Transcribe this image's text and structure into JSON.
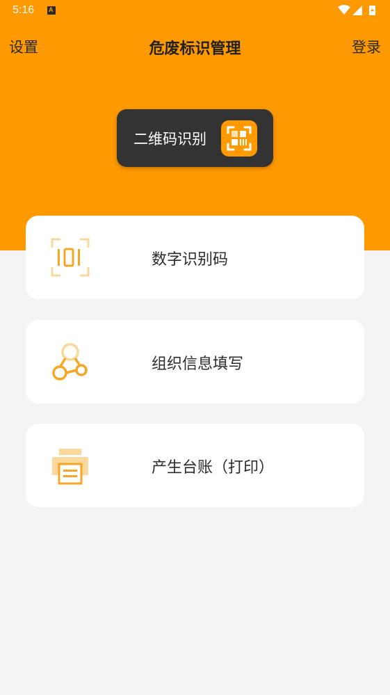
{
  "status_bar": {
    "time": "5:16"
  },
  "header": {
    "left_label": "设置",
    "title": "危废标识管理",
    "right_label": "登录"
  },
  "qr_button": {
    "label": "二维码识别",
    "icon": "qr-scan-icon"
  },
  "menu": {
    "items": [
      {
        "label": "数字识别码",
        "icon": "digit-scan-icon"
      },
      {
        "label": "组织信息填写",
        "icon": "organization-icon"
      },
      {
        "label": "产生台账（打印）",
        "icon": "printer-icon"
      }
    ]
  },
  "colors": {
    "accent": "#ff9900",
    "dark_button": "#333333",
    "background": "#f4f4f4",
    "card": "#ffffff",
    "icon_orange": "#f5a623",
    "icon_light": "#fad89c"
  }
}
